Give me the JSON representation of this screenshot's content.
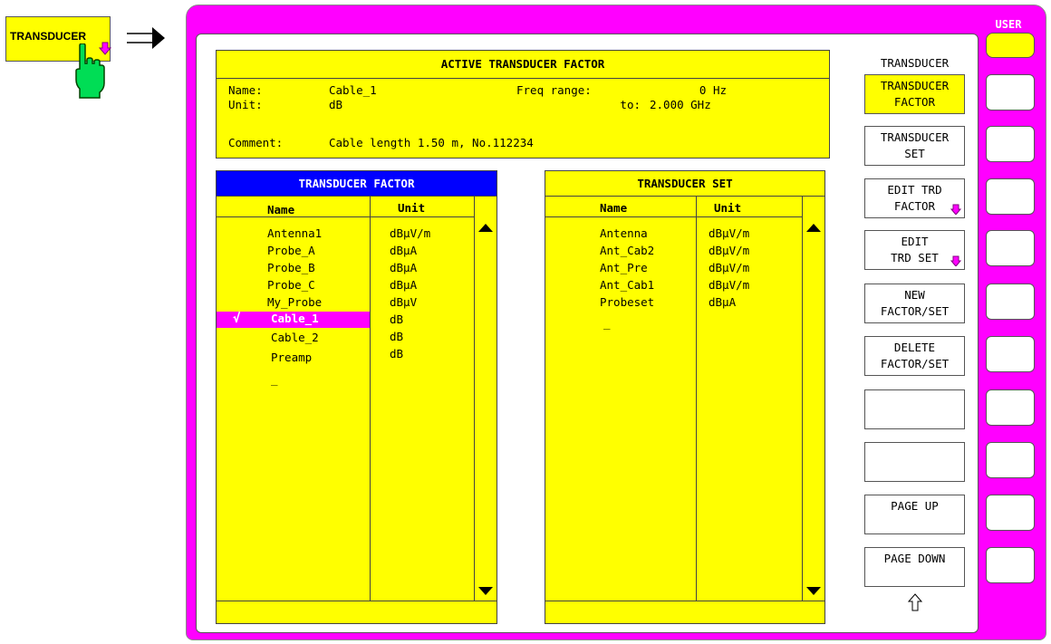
{
  "hardkey": {
    "label": "TRANSDUCER"
  },
  "user_label": "USER",
  "active": {
    "title": "ACTIVE TRANSDUCER FACTOR",
    "name_label": "Name:",
    "name_value": "Cable_1",
    "unit_label": "Unit:",
    "unit_value": "dB",
    "freq_label": "Freq range:",
    "freq_from": "0 Hz",
    "to_label": "to:",
    "freq_to": "2.000 GHz",
    "comment_label": "Comment:",
    "comment_value": "Cable length 1.50 m, No.112234"
  },
  "factor_table": {
    "title": "TRANSDUCER FACTOR",
    "col_name": "Name",
    "col_unit": "Unit",
    "rows": [
      {
        "name": "Antenna1",
        "unit": "dBµV/m"
      },
      {
        "name": "Probe_A",
        "unit": "dBµA"
      },
      {
        "name": "Probe_B",
        "unit": "dBµA"
      },
      {
        "name": "Probe_C",
        "unit": "dBµA"
      },
      {
        "name": "My_Probe",
        "unit": "dBµV"
      },
      {
        "name": "Cable_1",
        "unit": "dB"
      },
      {
        "name": "Cable_2",
        "unit": "dB"
      },
      {
        "name": "Preamp",
        "unit": "dB"
      },
      {
        "name": "_",
        "unit": ""
      }
    ],
    "selected_index": 5,
    "check_mark": "√"
  },
  "set_table": {
    "title": "TRANSDUCER SET",
    "col_name": "Name",
    "col_unit": "Unit",
    "rows": [
      {
        "name": "Antenna",
        "unit": "dBµV/m"
      },
      {
        "name": "Ant_Cab2",
        "unit": "dBµV/m"
      },
      {
        "name": "Ant_Pre",
        "unit": "dBµV/m"
      },
      {
        "name": "Ant_Cab1",
        "unit": "dBµV/m"
      },
      {
        "name": "Probeset",
        "unit": "dBµA"
      },
      {
        "name": "_",
        "unit": ""
      }
    ]
  },
  "menu_title": "TRANSDUCER",
  "softkeys": [
    {
      "line1": "TRANSDUCER",
      "line2": "FACTOR",
      "active": true,
      "submenu": false
    },
    {
      "line1": "TRANSDUCER",
      "line2": "SET",
      "active": false,
      "submenu": false
    },
    {
      "line1": "EDIT TRD",
      "line2": "FACTOR",
      "active": false,
      "submenu": true
    },
    {
      "line1": "EDIT",
      "line2": "TRD SET",
      "active": false,
      "submenu": true
    },
    {
      "line1": "NEW",
      "line2": "FACTOR/SET",
      "active": false,
      "submenu": false
    },
    {
      "line1": "DELETE",
      "line2": "FACTOR/SET",
      "active": false,
      "submenu": false
    },
    {
      "line1": "",
      "line2": "",
      "active": false,
      "submenu": false
    },
    {
      "line1": "",
      "line2": "",
      "active": false,
      "submenu": false
    },
    {
      "line1": "PAGE UP",
      "line2": "",
      "active": false,
      "submenu": false
    },
    {
      "line1": "PAGE DOWN",
      "line2": "",
      "active": false,
      "submenu": false
    }
  ],
  "colors": {
    "frame": "#ff00ff",
    "panel": "#ffff00",
    "header_blue": "#0000ff",
    "selected": "#ff00ff",
    "hand": "#00dd55"
  }
}
